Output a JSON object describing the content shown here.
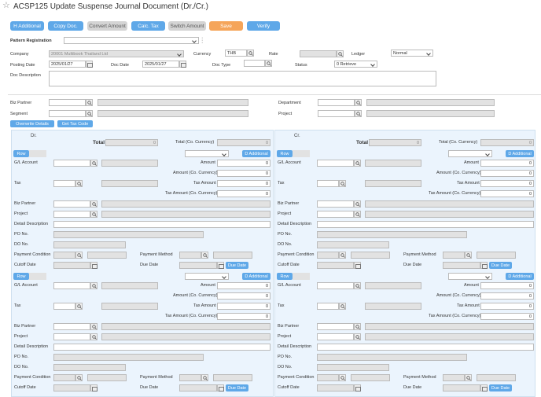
{
  "title": "ACSP125 Update Suspense Journal Document (Dr./Cr.)",
  "toolbar": {
    "h_additional": "H Additional",
    "copy_doc": "Copy Doc.",
    "convert_amount": "Convert Amount",
    "calc_tax": "Calc. Tax",
    "switch_amount": "Switch Amount",
    "save": "Save",
    "verify": "Verify"
  },
  "header": {
    "pattern_registration_label": "Pattern Registration",
    "pattern_registration_value": "",
    "company_label": "Company",
    "company_value": "20001 Multibook Thailand Ltd",
    "currency_label": "Currency",
    "currency_value": "THB",
    "rate_label": "Rate",
    "rate_value": "",
    "ledger_label": "Ledger",
    "ledger_value": "Normal",
    "posting_date_label": "Posting Date",
    "posting_date_value": "2025/01/27",
    "doc_date_label": "Doc Date",
    "doc_date_value": "2025/01/27",
    "doc_type_label": "Doc Type",
    "doc_type_value": "",
    "status_label": "Status",
    "status_value": "0 Retrieve",
    "doc_description_label": "Doc Description",
    "doc_description_value": ""
  },
  "partner": {
    "biz_partner_label": "Biz Partner",
    "segment_label": "Segment",
    "department_label": "Department",
    "project_label": "Project",
    "overwrite_details": "Overwrite Details",
    "get_tax_code": "Get Tax Code"
  },
  "dr": {
    "heading": "Dr.",
    "total_label": "Total",
    "total_value": "0",
    "total_cc_label": "Total (Co. Currency)",
    "total_cc_value": "0"
  },
  "cr": {
    "heading": "Cr.",
    "total_label": "Total",
    "total_value": "0",
    "total_cc_label": "Total (Co. Currency)",
    "total_cc_value": "0"
  },
  "line": {
    "row": "Row",
    "d_additional": "D Additional",
    "gl_account": "G/L Account",
    "amount": "Amount",
    "amount_value": "0",
    "amount_cc": "Amount (Co. Currency)",
    "amount_cc_value": "0",
    "tax": "Tax",
    "tax_amount": "Tax Amount",
    "tax_amount_value": "0",
    "tax_amount_cc": "Tax Amount (Co. Currency)",
    "tax_amount_cc_value": "0",
    "biz_partner": "Biz Partner",
    "project": "Project",
    "detail_description": "Detail Description",
    "po_no": "PO No.",
    "do_no": "DO No.",
    "payment_condition": "Payment Condition",
    "payment_method": "Payment Method",
    "cutoff_date": "Cutoff Date",
    "due_date": "Due Date",
    "due_date_button": "Due Date"
  }
}
